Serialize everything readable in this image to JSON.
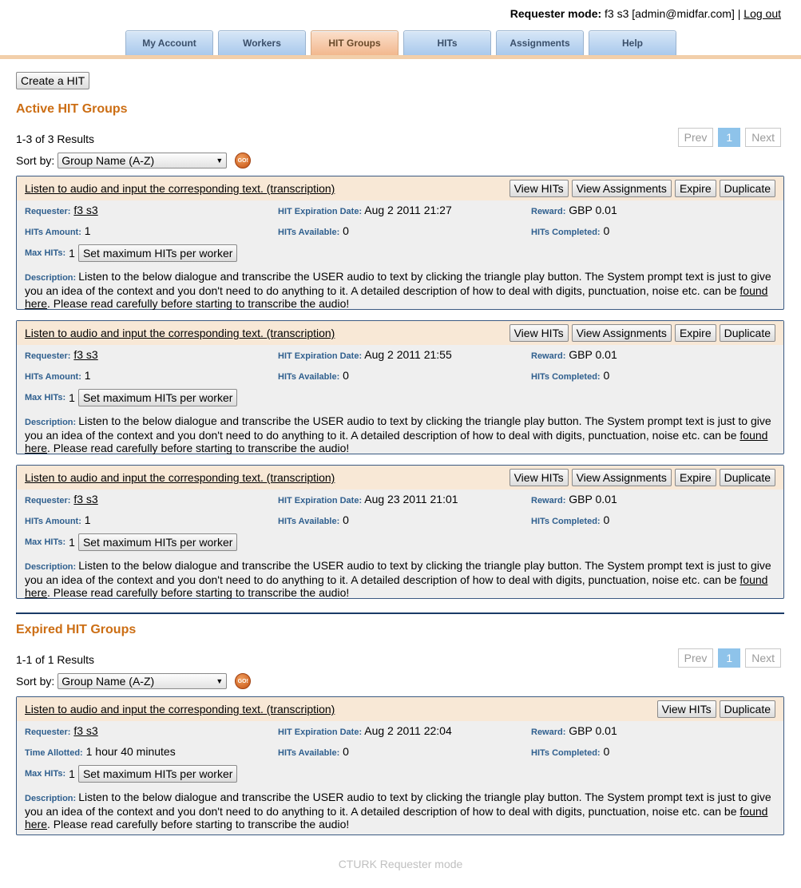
{
  "header": {
    "mode_label": "Requester mode:",
    "user": "f3 s3 [admin@midfar.com]",
    "separator": "|",
    "logout": "Log out"
  },
  "tabs": [
    {
      "label": "My Account",
      "active": false
    },
    {
      "label": "Workers",
      "active": false
    },
    {
      "label": "HIT Groups",
      "active": true
    },
    {
      "label": "HITs",
      "active": false
    },
    {
      "label": "Assignments",
      "active": false
    },
    {
      "label": "Help",
      "active": false
    }
  ],
  "create_button": "Create a HIT",
  "labels": {
    "requester": "Requester:",
    "expiration": "HIT Expiration Date:",
    "reward": "Reward:",
    "hits_amount": "HITs Amount:",
    "hits_available": "HITs Available:",
    "hits_completed": "HITs Completed:",
    "time_allotted": "Time Allotted:",
    "max_hits": "Max HITs:",
    "description": "Description:",
    "set_max": "Set maximum HITs per worker",
    "view_hits": "View HITs",
    "view_assignments": "View Assignments",
    "expire": "Expire",
    "duplicate": "Duplicate",
    "sort_by": "Sort by:",
    "sort_value": "Group Name (A-Z)",
    "go": "GO!",
    "prev": "Prev",
    "next": "Next",
    "page": "1"
  },
  "active": {
    "title": "Active HIT Groups",
    "results": "1-3 of 3 Results",
    "groups": [
      {
        "title": "Listen to audio and input the corresponding text. (transcription)",
        "requester": "f3 s3",
        "expiration": "Aug 2 2011 21:27",
        "reward": "GBP 0.01",
        "amount": "1",
        "available": "0",
        "completed": "0",
        "max": "1"
      },
      {
        "title": "Listen to audio and input the corresponding text. (transcription)",
        "requester": "f3 s3",
        "expiration": "Aug 2 2011 21:55",
        "reward": "GBP 0.01",
        "amount": "1",
        "available": "0",
        "completed": "0",
        "max": "1"
      },
      {
        "title": "Listen to audio and input the corresponding text. (transcription)",
        "requester": "f3 s3",
        "expiration": "Aug 23 2011 21:01",
        "reward": "GBP 0.01",
        "amount": "1",
        "available": "0",
        "completed": "0",
        "max": "1"
      }
    ]
  },
  "expired": {
    "title": "Expired HIT Groups",
    "results": "1-1 of 1 Results",
    "groups": [
      {
        "title": "Listen to audio and input the corresponding text. (transcription)",
        "requester": "f3 s3",
        "expiration": "Aug 2 2011 22:04",
        "reward": "GBP 0.01",
        "time_allotted": "1 hour 40 minutes",
        "available": "0",
        "completed": "0",
        "max": "1"
      }
    ]
  },
  "description": {
    "text_before": "Listen to the below dialogue and transcribe the USER audio to text by clicking the triangle play button. The System prompt text is just to give you an idea of the context and you don't need to do anything to it. A detailed description of how to deal with digits, punctuation, noise etc. can be",
    "link": "found here",
    "text_after": ". Please read carefully before starting to transcribe the audio!"
  },
  "footer": "CTURK Requester mode"
}
